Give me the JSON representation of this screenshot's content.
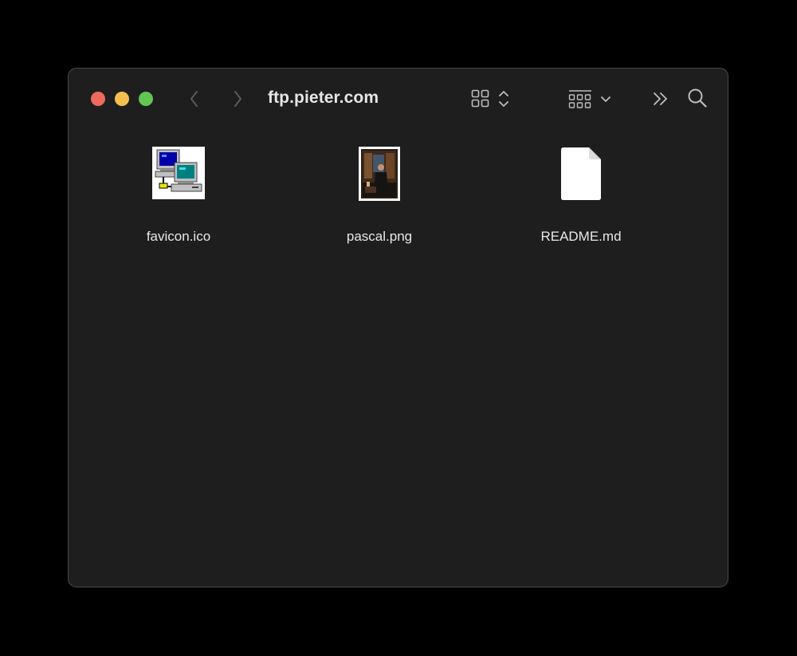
{
  "window": {
    "title": "ftp.pieter.com",
    "traffic_lights": {
      "close_color": "#ed6a5e",
      "minimize_color": "#f5bf4f",
      "maximize_color": "#62c554"
    }
  },
  "toolbar": {
    "icons": [
      "chevron-left-icon",
      "chevron-right-icon",
      "grid-view-icon",
      "sort-arrows-icon",
      "group-view-icon",
      "chevron-down-icon",
      "double-chevron-right-icon",
      "search-icon"
    ]
  },
  "files": [
    {
      "name": "favicon.ico",
      "icon": "networked-computers-icon"
    },
    {
      "name": "pascal.png",
      "icon": "image-thumbnail-icon"
    },
    {
      "name": "README.md",
      "icon": "blank-document-icon"
    }
  ],
  "colors": {
    "background": "#000000",
    "window_bg": "#1e1e1e",
    "text": "#e8e8e8"
  }
}
